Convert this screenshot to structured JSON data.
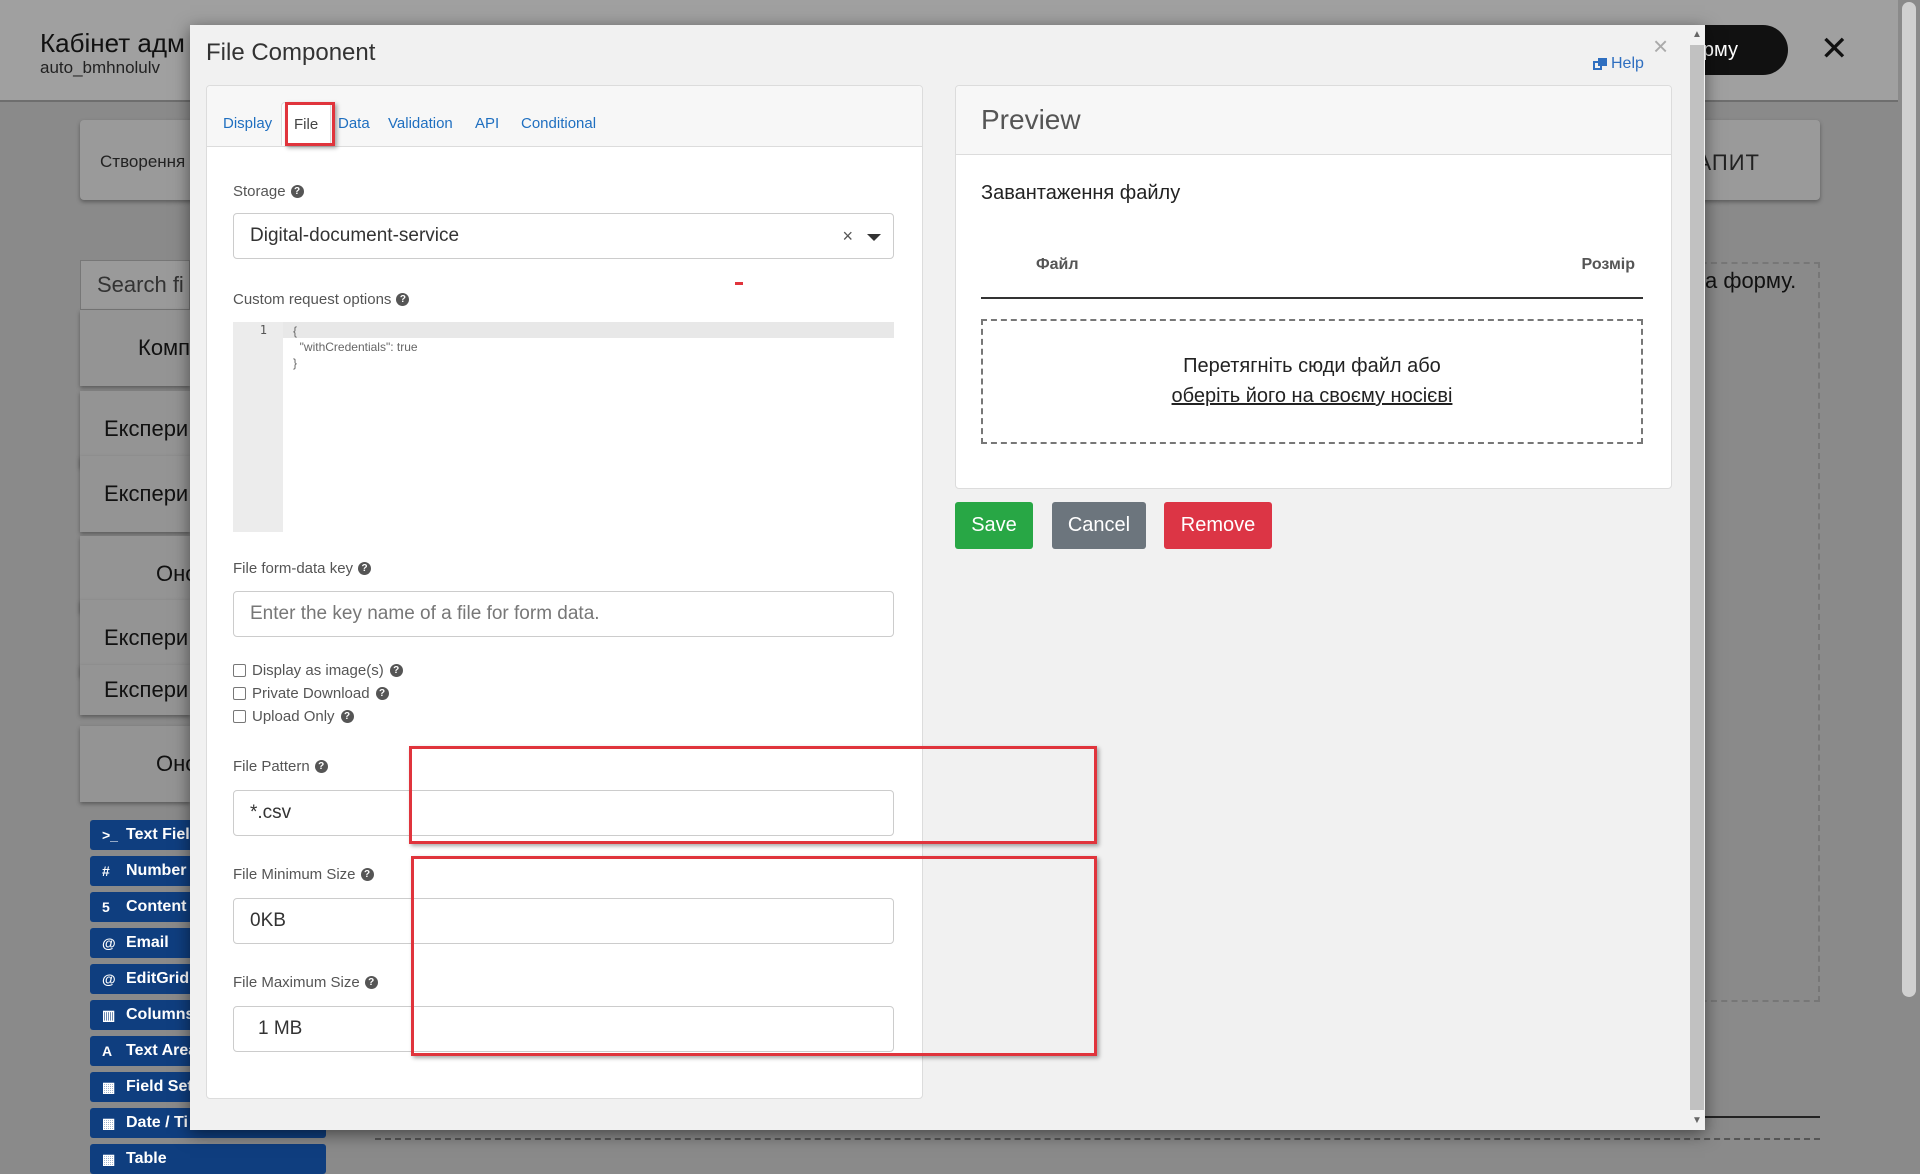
{
  "background": {
    "header_title": "Кабінет адм",
    "header_subtitle": "auto_bmhnolulv",
    "header_button": "орму",
    "bar_left": "Створення",
    "bar_right": "АПИТ",
    "search_placeholder": "Search fi",
    "cards": [
      "Комп",
      "Експери",
      "Експери",
      "Оно",
      "Експери",
      "Експери",
      "Оно"
    ],
    "drop_text": "а форму.",
    "components": [
      {
        "icon": ">_",
        "label": "Text Field"
      },
      {
        "icon": "#",
        "label": "Number"
      },
      {
        "icon": "5",
        "label": "Content"
      },
      {
        "icon": "@",
        "label": "Email"
      },
      {
        "icon": "@",
        "label": "EditGrid"
      },
      {
        "icon": "▥",
        "label": "Columns"
      },
      {
        "icon": "A",
        "label": "Text Area"
      },
      {
        "icon": "▦",
        "label": "Field Set"
      },
      {
        "icon": "▦",
        "label": "Date / Ti"
      },
      {
        "icon": "▦",
        "label": "Table"
      }
    ]
  },
  "modal": {
    "title": "File Component",
    "help": "Help",
    "tabs": [
      "Display",
      "File",
      "Data",
      "Validation",
      "API",
      "Conditional"
    ],
    "active_tab": "File",
    "storage": {
      "label": "Storage",
      "value": "Digital-document-service"
    },
    "custom_request": {
      "label": "Custom request options",
      "line_number": "1",
      "code": "{\n  \"withCredentials\": true\n}"
    },
    "form_data_key": {
      "label": "File form-data key",
      "placeholder": "Enter the key name of a file for form data."
    },
    "checkboxes": [
      "Display as image(s)",
      "Private Download",
      "Upload Only"
    ],
    "file_pattern": {
      "label": "File Pattern",
      "value": "*.csv"
    },
    "file_min_size": {
      "label": "File Minimum Size",
      "value": "0KB"
    },
    "file_max_size": {
      "label": "File Maximum Size",
      "value": "1 MB"
    }
  },
  "preview": {
    "title": "Preview",
    "upload_label": "Завантаження файлу",
    "col_file": "Файл",
    "col_size": "Розмір",
    "drop_line1": "Перетягніть сюди файл або",
    "drop_line2": "оберіть його на своєму носієві"
  },
  "buttons": {
    "save": "Save",
    "cancel": "Cancel",
    "remove": "Remove"
  },
  "colors": {
    "save": "#28a745",
    "cancel": "#6c757d",
    "remove": "#dc3545",
    "link": "#1f6fc0",
    "highlight": "#e0343c"
  }
}
